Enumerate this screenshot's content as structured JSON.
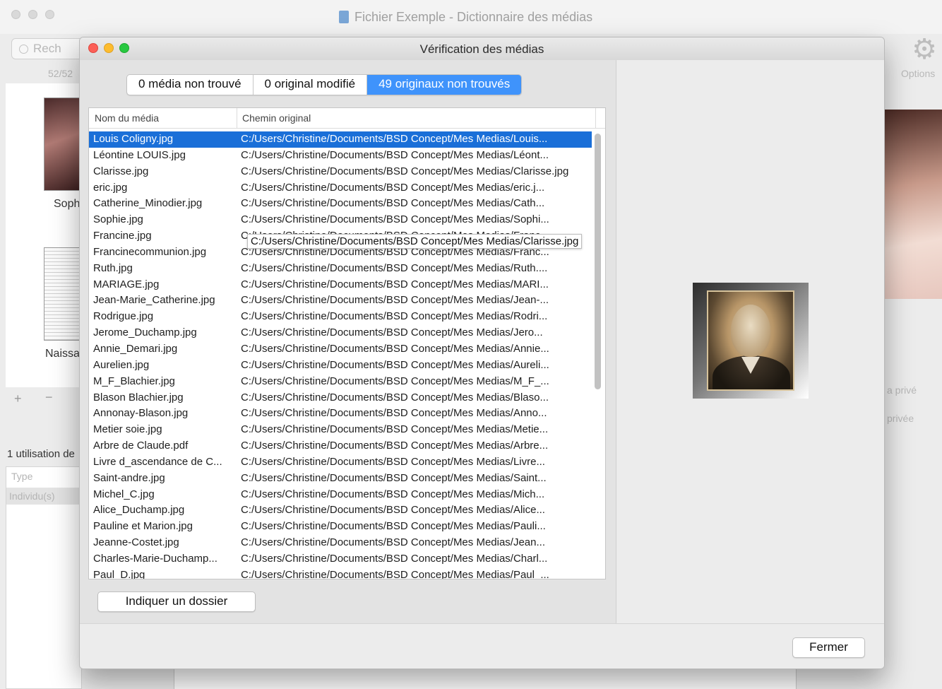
{
  "main_window": {
    "title": "Fichier Exemple - Dictionnaire des médias",
    "search_placeholder": "Rech",
    "counter": "52/52",
    "options_label": "Options",
    "thumb_labels": [
      "Soph",
      "Naissa"
    ],
    "plus": "+",
    "minus": "−",
    "usage_text": "1 utilisation de",
    "type_column": "Type",
    "individual_row": "Individu(s)",
    "right_labels": [
      "a privé",
      "privée"
    ]
  },
  "dialog": {
    "title": "Vérification des médias",
    "tabs": [
      {
        "label": "0 média non trouvé",
        "active": false
      },
      {
        "label": "0 original modifié",
        "active": false
      },
      {
        "label": "49 originaux non trouvés",
        "active": true
      }
    ],
    "columns": {
      "name": "Nom du média",
      "path": "Chemin original"
    },
    "rows": [
      {
        "name": "Louis Coligny.jpg",
        "path": "C:/Users/Christine/Documents/BSD Concept/Mes Medias/Louis...",
        "selected": true
      },
      {
        "name": "Léontine LOUIS.jpg",
        "path": "C:/Users/Christine/Documents/BSD Concept/Mes Medias/Léont..."
      },
      {
        "name": "Clarisse.jpg",
        "path": "C:/Users/Christine/Documents/BSD Concept/Mes Medias/Clarisse.jpg"
      },
      {
        "name": "eric.jpg",
        "path": "C:/Users/Christine/Documents/BSD Concept/Mes Medias/eric.j..."
      },
      {
        "name": "Catherine_Minodier.jpg",
        "path": "C:/Users/Christine/Documents/BSD Concept/Mes Medias/Cath..."
      },
      {
        "name": "Sophie.jpg",
        "path": "C:/Users/Christine/Documents/BSD Concept/Mes Medias/Sophi..."
      },
      {
        "name": "Francine.jpg",
        "path": "C:/Users/Christine/Documents/BSD Concept/Mes Medias/Franc..."
      },
      {
        "name": "Francinecommunion.jpg",
        "path": "C:/Users/Christine/Documents/BSD Concept/Mes Medias/Franc..."
      },
      {
        "name": "Ruth.jpg",
        "path": "C:/Users/Christine/Documents/BSD Concept/Mes Medias/Ruth...."
      },
      {
        "name": "MARIAGE.jpg",
        "path": "C:/Users/Christine/Documents/BSD Concept/Mes Medias/MARI..."
      },
      {
        "name": "Jean-Marie_Catherine.jpg",
        "path": "C:/Users/Christine/Documents/BSD Concept/Mes Medias/Jean-..."
      },
      {
        "name": "Rodrigue.jpg",
        "path": "C:/Users/Christine/Documents/BSD Concept/Mes Medias/Rodri..."
      },
      {
        "name": "Jerome_Duchamp.jpg",
        "path": "C:/Users/Christine/Documents/BSD Concept/Mes Medias/Jero..."
      },
      {
        "name": "Annie_Demari.jpg",
        "path": "C:/Users/Christine/Documents/BSD Concept/Mes Medias/Annie..."
      },
      {
        "name": "Aurelien.jpg",
        "path": "C:/Users/Christine/Documents/BSD Concept/Mes Medias/Aureli..."
      },
      {
        "name": "M_F_Blachier.jpg",
        "path": "C:/Users/Christine/Documents/BSD Concept/Mes Medias/M_F_..."
      },
      {
        "name": "Blason Blachier.jpg",
        "path": "C:/Users/Christine/Documents/BSD Concept/Mes Medias/Blaso..."
      },
      {
        "name": "Annonay-Blason.jpg",
        "path": "C:/Users/Christine/Documents/BSD Concept/Mes Medias/Anno..."
      },
      {
        "name": "Metier soie.jpg",
        "path": "C:/Users/Christine/Documents/BSD Concept/Mes Medias/Metie..."
      },
      {
        "name": "Arbre de Claude.pdf",
        "path": "C:/Users/Christine/Documents/BSD Concept/Mes Medias/Arbre..."
      },
      {
        "name": "Livre d_ascendance de C...",
        "path": "C:/Users/Christine/Documents/BSD Concept/Mes Medias/Livre..."
      },
      {
        "name": "Saint-andre.jpg",
        "path": "C:/Users/Christine/Documents/BSD Concept/Mes Medias/Saint..."
      },
      {
        "name": "Michel_C.jpg",
        "path": "C:/Users/Christine/Documents/BSD Concept/Mes Medias/Mich..."
      },
      {
        "name": "Alice_Duchamp.jpg",
        "path": "C:/Users/Christine/Documents/BSD Concept/Mes Medias/Alice..."
      },
      {
        "name": "Pauline et Marion.jpg",
        "path": "C:/Users/Christine/Documents/BSD Concept/Mes Medias/Pauli..."
      },
      {
        "name": "Jeanne-Costet.jpg",
        "path": "C:/Users/Christine/Documents/BSD Concept/Mes Medias/Jean..."
      },
      {
        "name": "Charles-Marie-Duchamp...",
        "path": "C:/Users/Christine/Documents/BSD Concept/Mes Medias/Charl..."
      },
      {
        "name": "Paul_D.jpg",
        "path": "C:/Users/Christine/Documents/BSD Concept/Mes Medias/Paul_..."
      }
    ],
    "tooltip": "C:/Users/Christine/Documents/BSD Concept/Mes Medias/Clarisse.jpg",
    "folder_button": "Indiquer un dossier",
    "close_button": "Fermer",
    "colors": {
      "selection": "#1a6fd8",
      "active_tab": "#3f93fb"
    }
  }
}
